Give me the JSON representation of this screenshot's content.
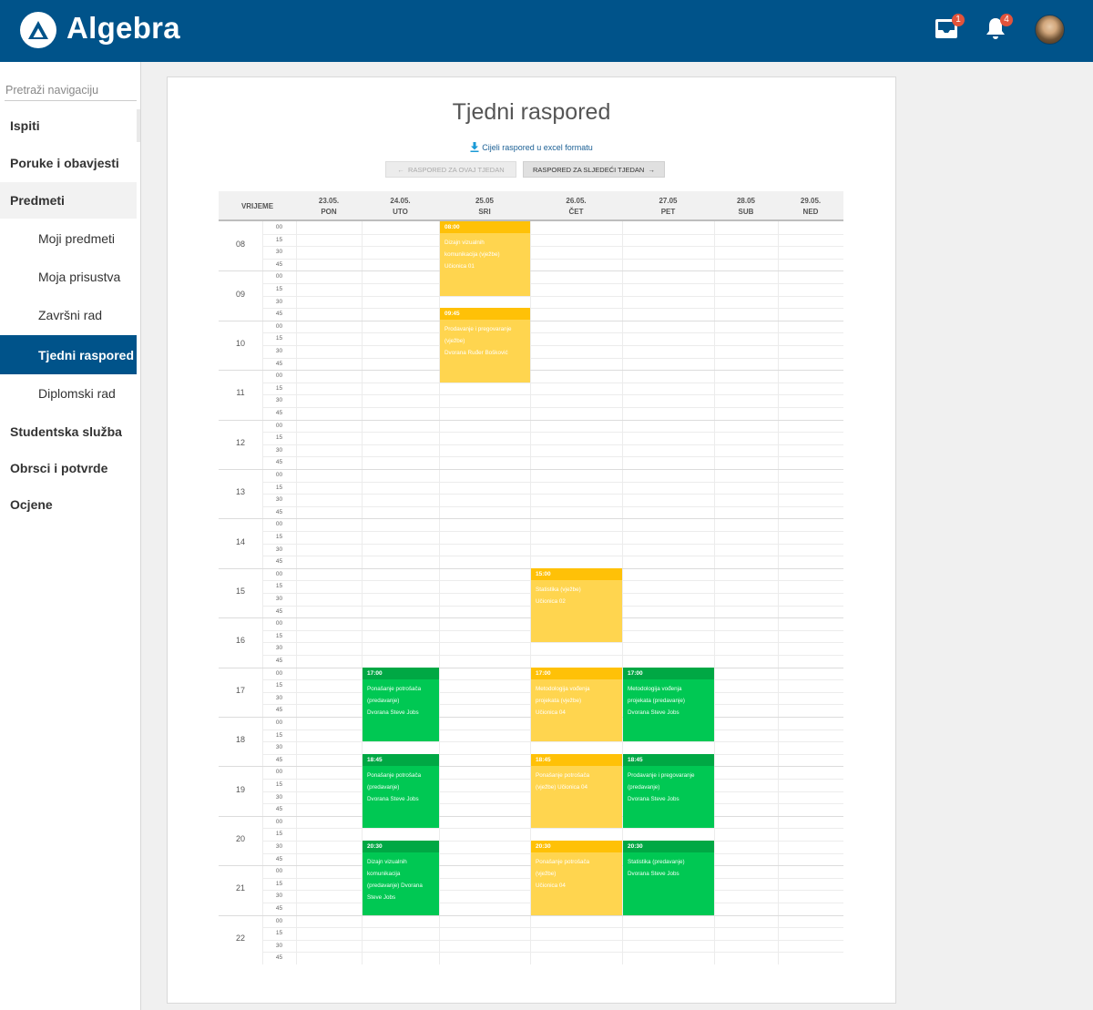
{
  "app": {
    "logo_text": "Algebra",
    "inbox_badge": "1",
    "notif_badge": "4"
  },
  "sidebar": {
    "search_placeholder": "Pretraži navigaciju",
    "items": [
      {
        "label": "Ispiti",
        "level": 1
      },
      {
        "label": "Poruke i obavjesti",
        "level": 1
      },
      {
        "label": "Predmeti",
        "level": 1
      },
      {
        "label": "Moji predmeti",
        "level": 2
      },
      {
        "label": "Moja prisustva",
        "level": 2
      },
      {
        "label": "Završni rad",
        "level": 2
      },
      {
        "label": "Tjedni raspored",
        "level": 2
      },
      {
        "label": "Diplomski rad",
        "level": 2
      },
      {
        "label": "Studentska služba",
        "level": 1
      },
      {
        "label": "Obrsci i potvrde",
        "level": 1
      },
      {
        "label": "Ocjene",
        "level": 1
      }
    ]
  },
  "page": {
    "title": "Tjedni raspored",
    "excel_link": "Cijeli raspored u excel formatu",
    "btn_prev": "Raspored za ovaj tjedan",
    "btn_next": "Raspored za sljedeći tjedan"
  },
  "schedule": {
    "time_header": "VRIJEME",
    "days": [
      {
        "date": "23.05.",
        "day": "PON"
      },
      {
        "date": "24.05.",
        "day": "UTO"
      },
      {
        "date": "25.05",
        "day": "SRI"
      },
      {
        "date": "26.05.",
        "day": "ČET"
      },
      {
        "date": "27.05",
        "day": "PET"
      },
      {
        "date": "28.05",
        "day": "SUB"
      },
      {
        "date": "29.05.",
        "day": "NED"
      }
    ],
    "hours": [
      "08",
      "09",
      "10",
      "11",
      "12",
      "13",
      "14",
      "15",
      "16",
      "17",
      "18",
      "19",
      "20",
      "21",
      "22"
    ],
    "minutes": [
      "00",
      "15",
      "30",
      "45"
    ],
    "events": [
      {
        "day": 2,
        "start": "08:00",
        "duration_slots": 6,
        "color": "yellow",
        "lines": [
          "Dizajn vizualnih",
          "komunikacija (vježbe)",
          "Učionica 01"
        ]
      },
      {
        "day": 2,
        "start": "09:45",
        "duration_slots": 6,
        "color": "yellow",
        "lines": [
          "Prodavanje i pregovaranje",
          "(vježbe)",
          "Dvorana Ruđer Bošković"
        ]
      },
      {
        "day": 3,
        "start": "15:00",
        "duration_slots": 6,
        "color": "yellow",
        "lines": [
          "Statistika (vježbe)",
          "Učionica 02"
        ]
      },
      {
        "day": 1,
        "start": "17:00",
        "duration_slots": 6,
        "color": "green",
        "lines": [
          "Ponašanje potrošača",
          "(predavanje)",
          "Dvorana Steve Jobs"
        ]
      },
      {
        "day": 3,
        "start": "17:00",
        "duration_slots": 6,
        "color": "yellow",
        "lines": [
          "Metodologija vođenja",
          "projekata (vježbe)",
          "Učionica 04"
        ]
      },
      {
        "day": 4,
        "start": "17:00",
        "duration_slots": 6,
        "color": "green",
        "lines": [
          "Metodologija vođenja",
          "projekata (predavanje)",
          "Dvorana Steve Jobs"
        ]
      },
      {
        "day": 1,
        "start": "18:45",
        "duration_slots": 6,
        "color": "green",
        "lines": [
          "Ponašanje potrošača",
          "(predavanje)",
          "Dvorana Steve Jobs"
        ]
      },
      {
        "day": 3,
        "start": "18:45",
        "duration_slots": 6,
        "color": "yellow",
        "lines": [
          "Ponašanje potrošača",
          "(vježbe) Učionica 04"
        ]
      },
      {
        "day": 4,
        "start": "18:45",
        "duration_slots": 6,
        "color": "green",
        "lines": [
          "Prodavanje i pregovaranje",
          "(predavanje)",
          "Dvorana Steve Jobs"
        ]
      },
      {
        "day": 1,
        "start": "20:30",
        "duration_slots": 6,
        "color": "green",
        "lines": [
          "Dizajn vizualnih",
          "komunikacija",
          "(predavanje) Dvorana",
          "Steve Jobs"
        ]
      },
      {
        "day": 3,
        "start": "20:30",
        "duration_slots": 6,
        "color": "yellow",
        "lines": [
          "Ponašanje potrošača",
          "(vježbe)",
          "Učionica 04"
        ]
      },
      {
        "day": 4,
        "start": "20:30",
        "duration_slots": 6,
        "color": "green",
        "lines": [
          "Statistika (predavanje)",
          "Dvorana Steve Jobs"
        ]
      }
    ]
  }
}
